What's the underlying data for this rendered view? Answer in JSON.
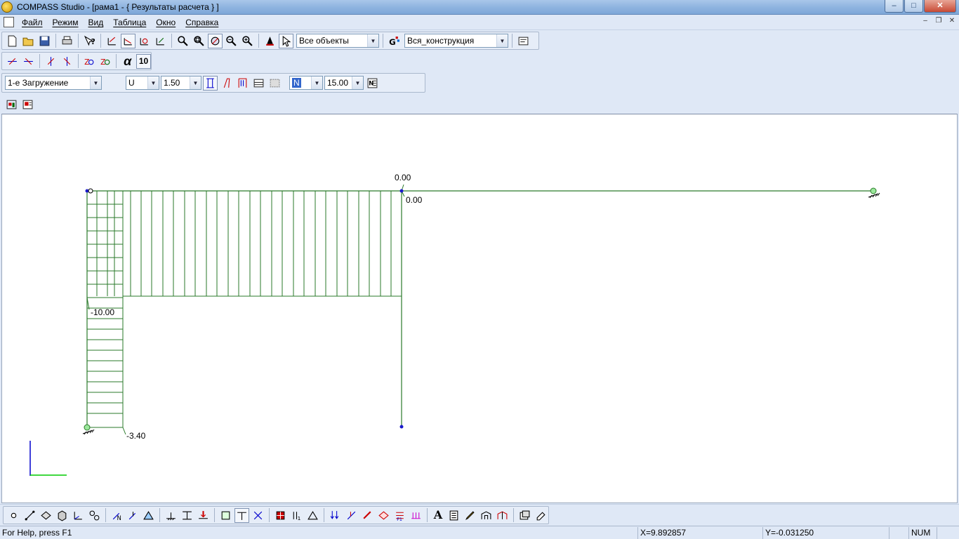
{
  "window": {
    "title": "COMPASS  Studio - [рама1 - { Результаты расчета } ]"
  },
  "menu": [
    "Файл",
    "Режим",
    "Вид",
    "Таблица",
    "Окно",
    "Справка"
  ],
  "toolbar": {
    "objects_filter": "Все объекты",
    "group_filter": "Вся_конструкция",
    "angle_value": "10"
  },
  "results_toolbar": {
    "load_case": "1-е Загружение",
    "component": "U",
    "scale": "1.50",
    "force_type": "N",
    "font_size": "15.00"
  },
  "canvas": {
    "labels": {
      "top_node_upper": "0.00",
      "top_node_lower": "0.00",
      "left_top": "-10.00",
      "left_bottom": "-3.40"
    },
    "colors": {
      "diagram": "#2a7a2a",
      "node": "#1a1acc",
      "axis_y": "#0000cc",
      "axis_x": "#00cc00"
    }
  },
  "statusbar": {
    "help": "For Help, press F1",
    "x_coord": "X=9.892857",
    "y_coord": "Y=-0.031250",
    "num": "NUM"
  }
}
